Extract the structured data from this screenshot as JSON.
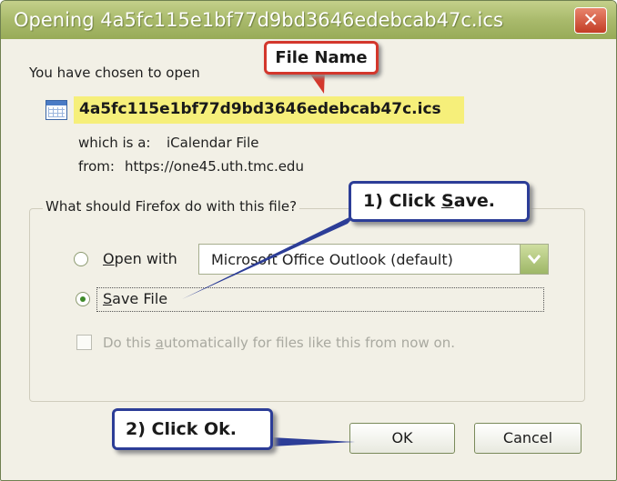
{
  "dialog": {
    "title": "Opening 4a5fc115e1bf77d9bd3646edebcab47c.ics",
    "close_label": "✕",
    "chosen_text": "You have chosen to open",
    "file_name": "4a5fc115e1bf77d9bd3646edebcab47c.ics",
    "which_is_label": "which is a:",
    "which_is_value": "iCalendar File",
    "from_label": "from:",
    "from_value": "https://one45.uth.tmc.edu"
  },
  "action_group": {
    "legend": "What should Firefox do with this file?",
    "open_with": {
      "prefix": "",
      "accel": "O",
      "suffix": "pen with",
      "selected": false
    },
    "app_select": {
      "value": "Microsoft Office Outlook (default)"
    },
    "save_file": {
      "prefix": "",
      "accel": "S",
      "suffix": "ave File",
      "selected": true
    },
    "auto": {
      "prefix": "Do this ",
      "accel": "a",
      "suffix": "utomatically for files like this from now on.",
      "checked": false
    }
  },
  "buttons": {
    "ok": "OK",
    "cancel": "Cancel"
  },
  "annotations": {
    "file_name": "File Name",
    "step1_prefix": "1)  Click ",
    "step1_accel": "S",
    "step1_suffix": "ave.",
    "step2": "2)  Click Ok."
  },
  "colors": {
    "titlebar": "#a9ba6c",
    "highlight": "#f6ef7a",
    "callout_blue": "#2c3d97",
    "callout_red": "#d3372c",
    "arrow": "#2c3d97"
  },
  "icons": {
    "file": "calendar-icon",
    "close": "close-icon",
    "dropdown": "chevron-down-icon"
  }
}
